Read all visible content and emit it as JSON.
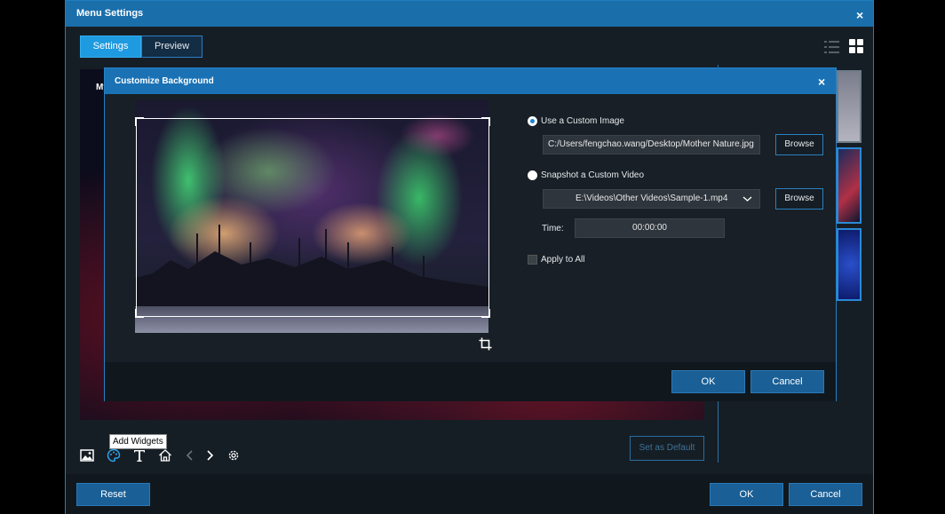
{
  "window": {
    "title": "Menu Settings"
  },
  "tabs": [
    {
      "label": "Settings"
    },
    {
      "label": "Preview"
    }
  ],
  "preview": {
    "menu_title": "My"
  },
  "toolbar": {
    "tooltip": "Add Widgets",
    "set_default_label": "Set as Default"
  },
  "footer": {
    "reset_label": "Reset",
    "ok_label": "OK",
    "cancel_label": "Cancel"
  },
  "dialog": {
    "title": "Customize Background",
    "custom_image": {
      "label": "Use a Custom Image",
      "path": "C:/Users/fengchao.wang/Desktop/Mother Nature.jpg",
      "browse_label": "Browse"
    },
    "custom_video": {
      "label": "Snapshot a Custom Video",
      "file": "E:\\Videos\\Other Videos\\Sample-1.mp4",
      "browse_label": "Browse"
    },
    "time": {
      "label": "Time:",
      "value": "00:00:00"
    },
    "apply_all_label": "Apply to All",
    "ok_label": "OK",
    "cancel_label": "Cancel"
  },
  "colors": {
    "title_bar": "#1a6fab",
    "accent": "#1e9ae0",
    "button": "#1a5f96"
  }
}
